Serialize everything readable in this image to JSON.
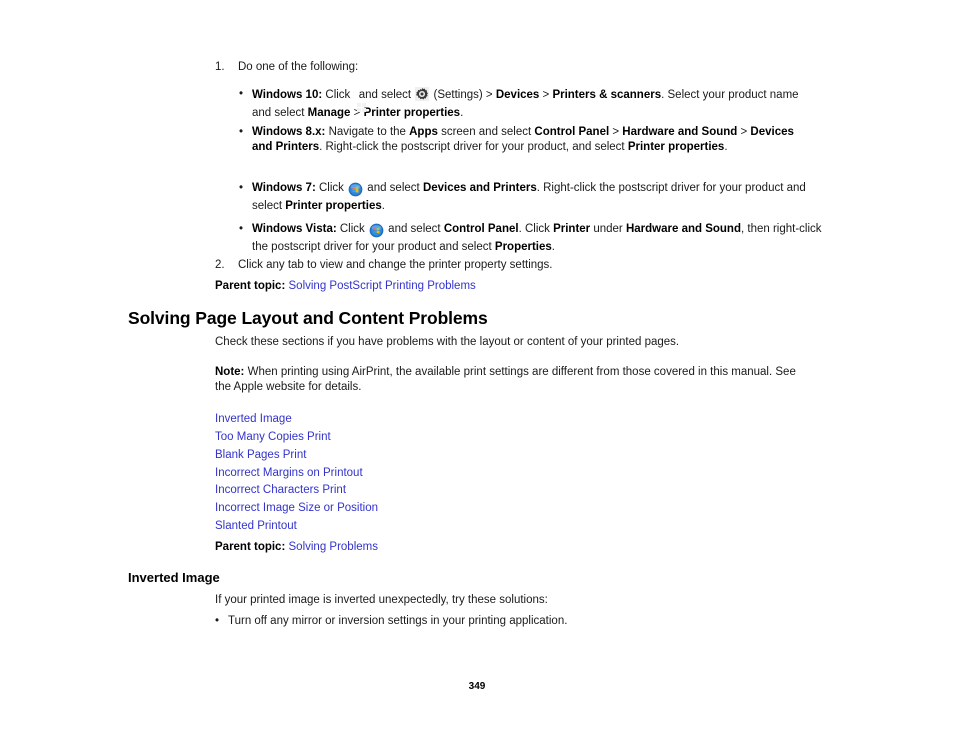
{
  "document": {
    "page_number": "349"
  },
  "steps": [
    {
      "number": "1.",
      "text": "Do one of the following:"
    },
    {
      "number": "2.",
      "text": "Click any tab to view and change the printer property settings."
    }
  ],
  "os_bullets": [
    {
      "icon_start": "windows-10-start-icon",
      "icon_settings": "settings-gear-icon",
      "os_label": "Windows 10:",
      "seg_1": " Click ",
      "seg_2": " and select ",
      "seg_3": " (Settings) > ",
      "bold_1": "Devices",
      "seg_4": " > ",
      "bold_2": "Printers & scanners",
      "seg_5": ". Select your product name and select ",
      "bold_3": "Manage",
      "seg_6": " > ",
      "bold_4": "Printer properties",
      "seg_7": "."
    },
    {
      "os_label": "Windows 8.x:",
      "seg_1": " Navigate to the ",
      "bold_1": "Apps",
      "seg_2": " screen and select ",
      "bold_2": "Control Panel",
      "seg_3": " > ",
      "bold_3": "Hardware and Sound",
      "seg_4": " > ",
      "bold_4": "Devices and Printers",
      "seg_5": ". Right-click the postscript driver for your product, and select ",
      "bold_5": "Printer properties",
      "seg_6": "."
    },
    {
      "icon_orb": "windows-orb-icon",
      "os_label": "Windows 7:",
      "seg_1": " Click ",
      "seg_2": " and select ",
      "bold_1": "Devices and Printers",
      "seg_3": ". Right-click the postscript driver for your product and select ",
      "bold_2": "Printer properties",
      "seg_4": "."
    },
    {
      "icon_orb": "windows-orb-icon",
      "os_label": "Windows Vista:",
      "seg_1": " Click ",
      "seg_2": " and select ",
      "bold_1": "Control Panel",
      "seg_3": ". Click ",
      "bold_2": "Printer",
      "seg_4": " under ",
      "bold_3": "Hardware and Sound",
      "seg_5": ", then right-click the postscript driver for your product and select ",
      "bold_4": "Properties",
      "seg_6": "."
    }
  ],
  "parent_topic_top": {
    "label": "Parent topic:",
    "link": "Solving PostScript Printing Problems"
  },
  "section_main": {
    "heading": "Solving Page Layout and Content Problems",
    "intro": "Check these sections if you have problems with the layout or content of your printed pages.",
    "note_label": "Note:",
    "note_text": " When printing using AirPrint, the available print settings are different from those covered in this manual. See the Apple website for details.",
    "links": [
      "Inverted Image",
      "Too Many Copies Print",
      "Blank Pages Print",
      "Incorrect Margins on Printout",
      "Incorrect Characters Print",
      "Incorrect Image Size or Position",
      "Slanted Printout"
    ],
    "parent_topic": {
      "label": "Parent topic:",
      "link": "Solving Problems"
    }
  },
  "section_inverted": {
    "heading": "Inverted Image",
    "intro": "If your printed image is inverted unexpectedly, try these solutions:",
    "bullets": [
      "Turn off any mirror or inversion settings in your printing application."
    ]
  },
  "colors": {
    "link": "#3333cc",
    "text": "#1a1a1a"
  }
}
